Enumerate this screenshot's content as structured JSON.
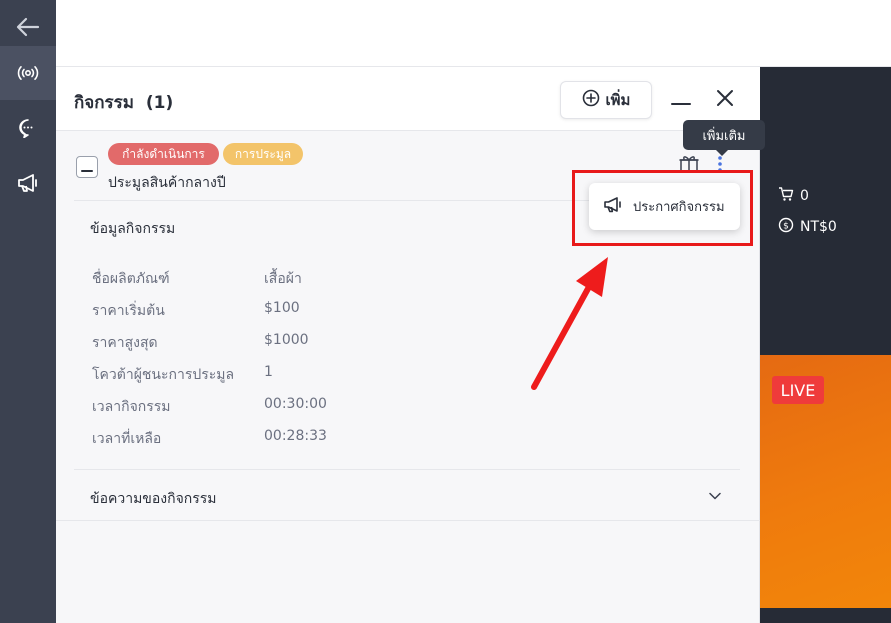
{
  "sidebar": {
    "items": [
      {
        "icon": "back-arrow-icon"
      },
      {
        "icon": "broadcast-icon",
        "active": true
      },
      {
        "icon": "chat-icon"
      },
      {
        "icon": "megaphone-icon"
      }
    ]
  },
  "panel": {
    "title": "กิจกรรม  (1)",
    "add_label": "เพิ่ม",
    "minimize_icon": "minimize-icon",
    "close_icon": "close-icon"
  },
  "activity": {
    "status_tag": "กำลังดำเนินการ",
    "type_tag": "การประมูล",
    "name": "ประมูลสินค้ากลางปี",
    "tag_colors": {
      "status": "#e26a6a",
      "type": "#f3c46a"
    }
  },
  "details": {
    "section_title": "ข้อมูลกิจกรรม",
    "rows": [
      {
        "label": "ชื่อผลิตภัณฑ์",
        "value": "เสื้อผ้า"
      },
      {
        "label": "ราคาเริ่มต้น",
        "value": "$100"
      },
      {
        "label": "ราคาสูงสุด",
        "value": "$1000"
      },
      {
        "label": "โควต้าผู้ชนะการประมูล",
        "value": "1"
      },
      {
        "label": "เวลากิจกรรม",
        "value": "00:30:00"
      },
      {
        "label": "เวลาที่เหลือ",
        "value": "00:28:33"
      }
    ]
  },
  "messages": {
    "section_title": "ข้อความของกิจกรรม"
  },
  "tooltip": {
    "text": "เพิ่มเติม"
  },
  "dropdown": {
    "item_label": "ประกาศกิจกรรม",
    "item_icon": "megaphone-icon"
  },
  "stream": {
    "cart_count": "0",
    "revenue": "NT$0",
    "live_label": "LIVE"
  },
  "colors": {
    "highlight": "#e8191a",
    "sidebar": "#3b4150",
    "live": "#ef3b3b"
  }
}
